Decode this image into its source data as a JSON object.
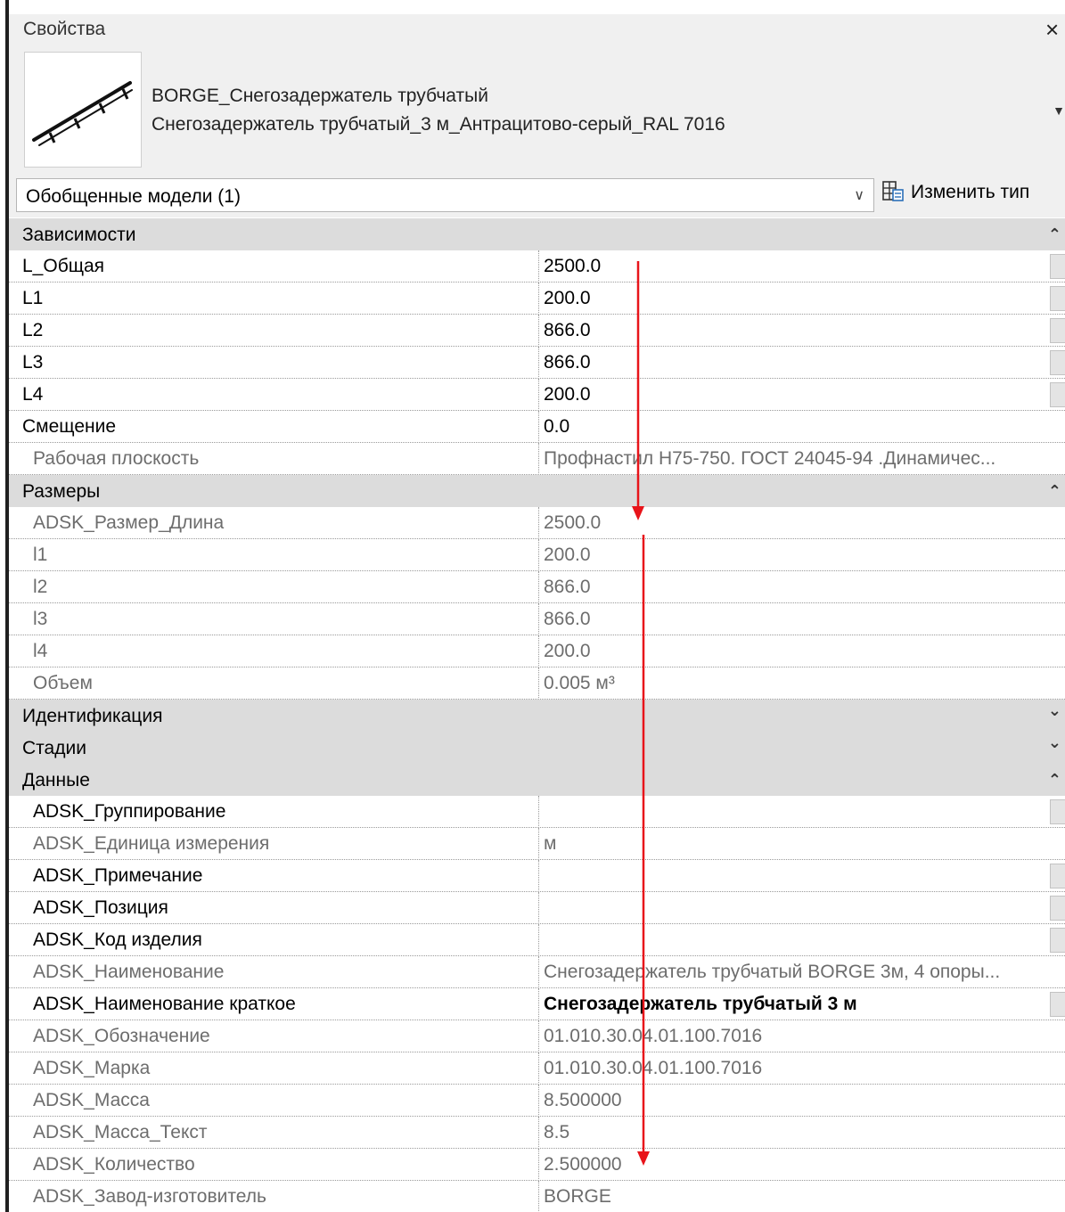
{
  "window": {
    "title": "Свойства",
    "close_glyph": "×"
  },
  "type": {
    "family": "BORGE_Снегозадержатель трубчатый",
    "name": "Снегозадержатель трубчатый_3 м_Антрацитово-серый_RAL 7016"
  },
  "selector": {
    "label": "Обобщенные модели (1)",
    "edit_type_label": "Изменить тип"
  },
  "groups": [
    {
      "label": "Зависимости",
      "expanded": true,
      "rows": [
        {
          "name": "L_Общая",
          "value": "2500.0",
          "readonly": false,
          "button": true
        },
        {
          "name": "L1",
          "value": "200.0",
          "readonly": false,
          "button": true
        },
        {
          "name": "L2",
          "value": "866.0",
          "readonly": false,
          "button": true
        },
        {
          "name": "L3",
          "value": "866.0",
          "readonly": false,
          "button": true
        },
        {
          "name": "L4",
          "value": "200.0",
          "readonly": false,
          "button": true
        },
        {
          "name": "Смещение",
          "value": "0.0",
          "readonly": false,
          "button": false
        },
        {
          "name": "Рабочая плоскость",
          "value": "Профнастил Н75-750. ГОСТ 24045-94 .Динамичес...",
          "readonly": true,
          "button": false
        }
      ]
    },
    {
      "label": "Размеры",
      "expanded": true,
      "rows": [
        {
          "name": "ADSK_Размер_Длина",
          "value": "2500.0",
          "readonly": true,
          "button": false
        },
        {
          "name": "l1",
          "value": "200.0",
          "readonly": true,
          "button": false
        },
        {
          "name": "l2",
          "value": "866.0",
          "readonly": true,
          "button": false
        },
        {
          "name": "l3",
          "value": "866.0",
          "readonly": true,
          "button": false
        },
        {
          "name": "l4",
          "value": "200.0",
          "readonly": true,
          "button": false
        },
        {
          "name": "Объем",
          "value": "0.005 м³",
          "readonly": true,
          "button": false
        }
      ]
    },
    {
      "label": "Идентификация",
      "expanded": false,
      "rows": []
    },
    {
      "label": "Стадии",
      "expanded": false,
      "rows": []
    },
    {
      "label": "Данные",
      "expanded": true,
      "rows": [
        {
          "name": "ADSK_Группирование",
          "value": "",
          "readonly": false,
          "button": true
        },
        {
          "name": "ADSK_Единица измерения",
          "value": "м",
          "readonly": true,
          "button": false
        },
        {
          "name": "ADSK_Примечание",
          "value": "",
          "readonly": false,
          "button": true
        },
        {
          "name": "ADSK_Позиция",
          "value": "",
          "readonly": false,
          "button": true
        },
        {
          "name": "ADSK_Код изделия",
          "value": "",
          "readonly": false,
          "button": true
        },
        {
          "name": "ADSK_Наименование",
          "value": "Снегозадержатель трубчатый BORGE 3м, 4 опоры...",
          "readonly": true,
          "button": false
        },
        {
          "name": "ADSK_Наименование краткое",
          "value": "Снегозадержатель трубчатый 3 м",
          "readonly": false,
          "button": true,
          "bold_value": true
        },
        {
          "name": "ADSK_Обозначение",
          "value": "01.010.30.04.01.100.7016",
          "readonly": true,
          "button": false
        },
        {
          "name": "ADSK_Марка",
          "value": "01.010.30.04.01.100.7016",
          "readonly": true,
          "button": false
        },
        {
          "name": "ADSK_Масса",
          "value": "8.500000",
          "readonly": true,
          "button": false
        },
        {
          "name": "ADSK_Масса_Текст",
          "value": "8.5",
          "readonly": true,
          "button": false
        },
        {
          "name": "ADSK_Количество",
          "value": "2.500000",
          "readonly": true,
          "button": false
        },
        {
          "name": "ADSK_Завод-изготовитель",
          "value": "BORGE",
          "readonly": true,
          "button": false
        }
      ]
    }
  ],
  "icons": {
    "close": "close-icon",
    "dropdown": "chevron-down-icon",
    "edit_type": "edit-type-icon",
    "collapse": "double-chevron-up-icon",
    "expand": "double-chevron-down-icon"
  },
  "colors": {
    "annotation_arrow": "#e8141a",
    "group_header": "#dcdcdc",
    "readonly_text": "#6d6d6d"
  }
}
